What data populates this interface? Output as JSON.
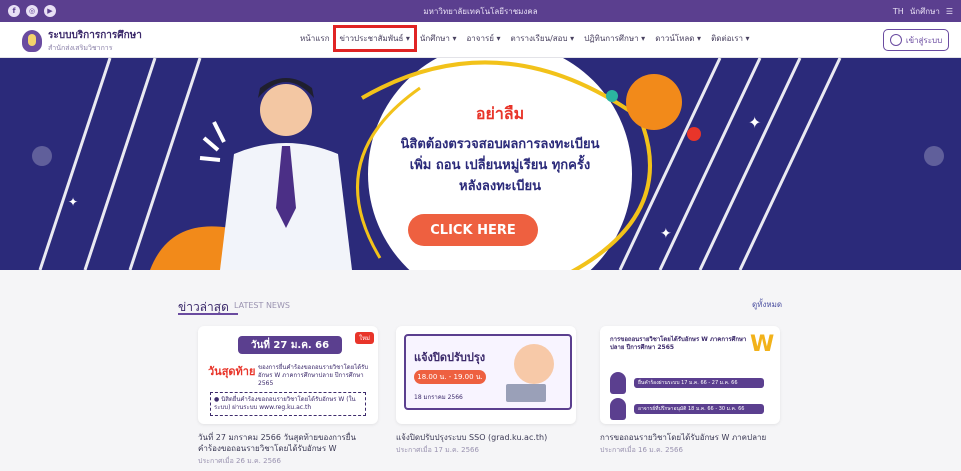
{
  "topbar": {
    "social": [
      "f",
      "◎",
      "▶"
    ],
    "center_text": "มหาวิทยาลัยเทคโนโลยีราชมงคล",
    "lang": "TH",
    "user": "นักศึกษา"
  },
  "nav": {
    "logo_title": "ระบบบริการการศึกษา",
    "logo_subtitle": "สำนักส่งเสริมวิชาการ",
    "menu": [
      "หน้าแรก",
      "ข่าวประชาสัมพันธ์ ▾",
      "นักศึกษา ▾",
      "อาจารย์ ▾",
      "ตารางเรียน/สอบ ▾",
      "ปฏิทินการศึกษา ▾",
      "ดาวน์โหลด ▾",
      "ติดต่อเรา ▾"
    ],
    "login_label": "เข้าสู่ระบบ"
  },
  "banner": {
    "headline": "อย่าลืม",
    "line1": "นิสิตต้องตรวจสอบผลการลงทะเบียน",
    "line2": "เพิ่ม ถอน เปลี่ยนหมู่เรียน ทุกครั้ง",
    "line3": "หลังลงทะเบียน",
    "cta": "CLICK HERE"
  },
  "news": {
    "title": "ข่าวล่าสุด",
    "subtitle": "LATEST NEWS",
    "more": "ดูทั้งหมด",
    "cards": [
      {
        "badge": "ใหม่",
        "thumb_date": "วันที่ 27 ม.ค. 66",
        "thumb_red": "วันสุดท้าย",
        "thumb_text": "ของการยื่นคำร้องขอถอนรายวิชาโดยได้รับอักษร W ภาคการศึกษาปลาย ปีการศึกษา 2565",
        "thumb_note": "● นิสิตยื่นคำร้องขอถอนรายวิชาโดยได้รับอักษร W (ในระบบ) ผ่านระบบ www.reg.ku.ac.th",
        "title": "วันที่ 27 มกราคม 2566 วันสุดท้ายของการยื่นคำร้องขอถอนรายวิชาโดยได้รับอักษร W",
        "meta": "ประกาศเมื่อ 26 ม.ค. 2566"
      },
      {
        "thumb_head": "แจ้งปิดปรับปรุง",
        "thumb_pill": "18.00 น. - 19.00 น.",
        "thumb_date": "18 มกราคม 2566",
        "title": "แจ้งปิดปรับปรุงระบบ SSO (grad.ku.ac.th)",
        "meta": "ประกาศเมื่อ 17 ม.ค. 2566"
      },
      {
        "thumb_title": "การขอถอนรายวิชาโดยได้รับอักษร W ภาคการศึกษาปลาย ปีการศึกษา 2565",
        "thumb_W": "W",
        "thumb_rows": [
          "ยื่นคำร้องผ่านระบบ 17 ม.ค. 66 - 27 ม.ค. 66",
          "อาจารย์ที่ปรึกษาอนุมัติ 18 ม.ค. 66 - 30 ม.ค. 66"
        ],
        "title": "การขอถอนรายวิชาโดยได้รับอักษร W ภาคปลาย",
        "meta": "ประกาศเมื่อ 16 ม.ค. 2566"
      }
    ]
  },
  "colors": {
    "primary": "#5b3f8f",
    "banner_bg": "#2b2a7a",
    "accent_red": "#e8352a",
    "cta": "#ee6040",
    "yellow": "#f2b21a"
  }
}
